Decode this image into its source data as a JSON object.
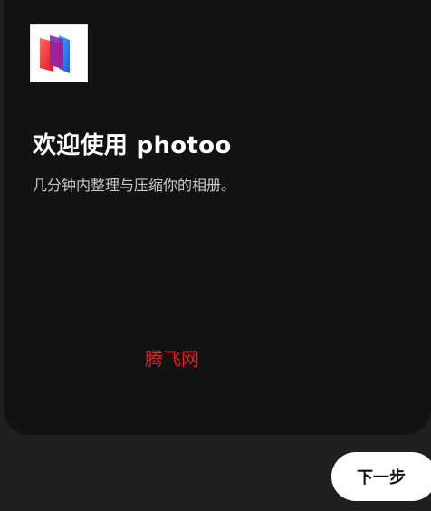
{
  "app": {
    "logo_icon": "photoo-logo-icon",
    "logo_colors": [
      "#ff3b30",
      "#1f6bff"
    ]
  },
  "welcome": {
    "title": "欢迎使用 photoo",
    "subtitle": "几分钟内整理与压缩你的相册。"
  },
  "watermark": {
    "text": "腾飞网",
    "color": "#e02020"
  },
  "footer": {
    "next_label": "下一步"
  },
  "colors": {
    "page_background": "#1f1f1f",
    "card_background": "#121212",
    "button_background": "#ffffff"
  }
}
